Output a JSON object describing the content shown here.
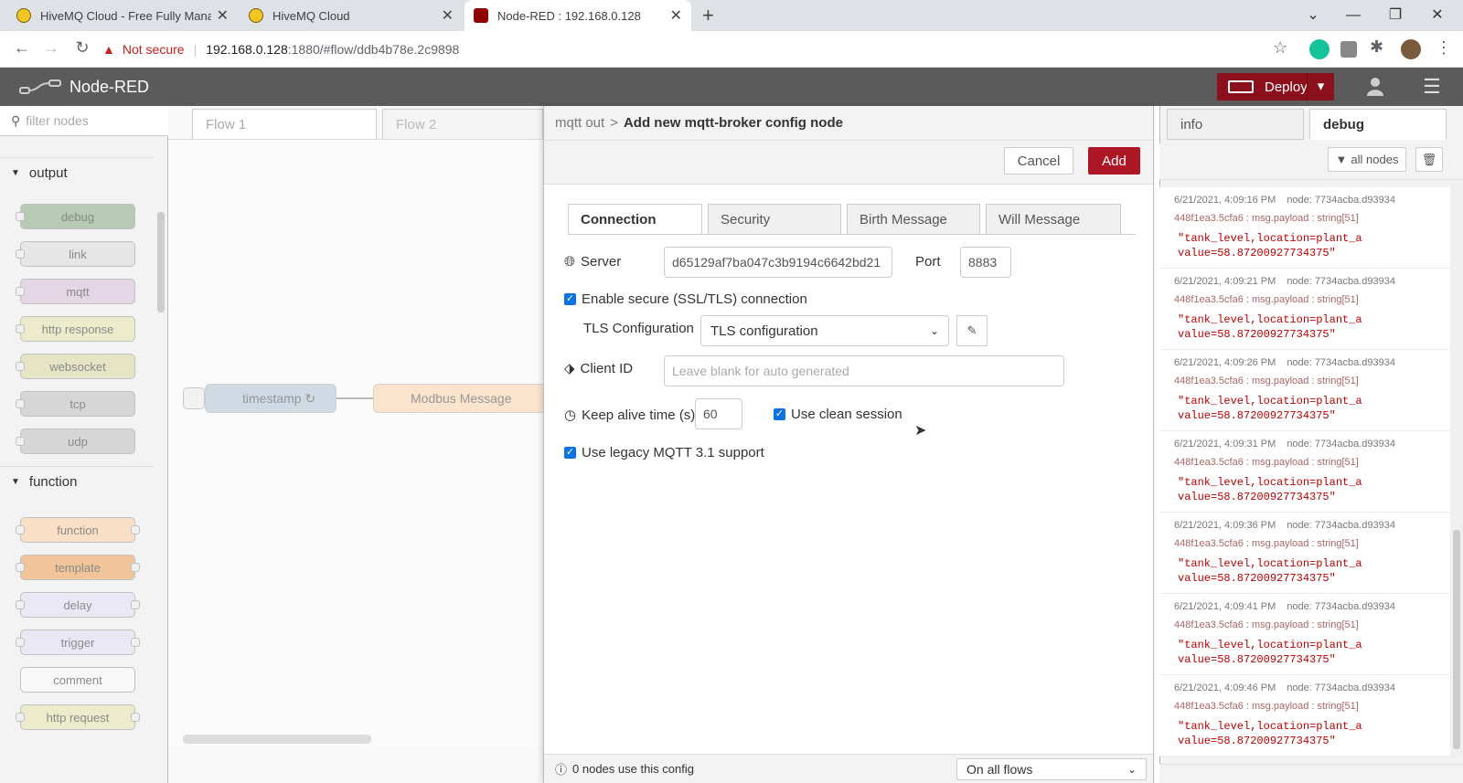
{
  "browser": {
    "tabs": [
      {
        "title": "HiveMQ Cloud - Free Fully Mana"
      },
      {
        "title": "HiveMQ Cloud"
      },
      {
        "title": "Node-RED : 192.168.0.128"
      }
    ],
    "security_label": "Not secure",
    "url_host": "192.168.0.128",
    "url_rest": ":1880/#flow/ddb4b78e.2c9898"
  },
  "app": {
    "name": "Node-RED",
    "deploy_label": "Deploy"
  },
  "palette": {
    "filter_placeholder": "filter nodes",
    "categories": [
      {
        "name": "output",
        "nodes": [
          "debug",
          "link",
          "mqtt",
          "http response",
          "websocket",
          "tcp",
          "udp"
        ]
      },
      {
        "name": "function",
        "nodes": [
          "function",
          "template",
          "delay",
          "trigger",
          "comment",
          "http request"
        ]
      }
    ]
  },
  "workspace": {
    "tabs": [
      "Flow 1",
      "Flow 2"
    ],
    "nodes": [
      {
        "label": "timestamp ↻"
      },
      {
        "label": "Modbus Message"
      }
    ]
  },
  "tray": {
    "breadcrumb_parent": "mqtt out",
    "breadcrumb_sep": ">",
    "title": "Add new mqtt-broker config node",
    "cancel_label": "Cancel",
    "add_label": "Add",
    "tabs": [
      "Connection",
      "Security",
      "Birth Message",
      "Will Message"
    ],
    "server_label": "Server",
    "server_value": "d65129af7ba047c3b9194c6642bd21",
    "port_label": "Port",
    "port_value": "8883",
    "tls_checkbox_label": "Enable secure (SSL/TLS) connection",
    "tls_config_label": "TLS Configuration",
    "tls_config_value": "TLS configuration",
    "client_id_label": "Client ID",
    "client_id_placeholder": "Leave blank for auto generated",
    "keepalive_label": "Keep alive time (s)",
    "keepalive_value": "60",
    "clean_session_label": "Use clean session",
    "legacy_label": "Use legacy MQTT 3.1 support",
    "footer_usage": "0 nodes use this config",
    "scope_value": "On all flows"
  },
  "sidebar": {
    "tabs": [
      "info",
      "debug"
    ],
    "filter_label": "all nodes",
    "messages": [
      {
        "time": "6/21/2021, 4:09:16 PM",
        "node": "node: 7734acba.d93934",
        "topic": "448f1ea3.5cfa6 : msg.payload : string[51]",
        "line1": "\"tank_level,location=plant_a",
        "line2": "value=58.87200927734375\""
      },
      {
        "time": "6/21/2021, 4:09:21 PM",
        "node": "node: 7734acba.d93934",
        "topic": "448f1ea3.5cfa6 : msg.payload : string[51]",
        "line1": "\"tank_level,location=plant_a",
        "line2": "value=58.87200927734375\""
      },
      {
        "time": "6/21/2021, 4:09:26 PM",
        "node": "node: 7734acba.d93934",
        "topic": "448f1ea3.5cfa6 : msg.payload : string[51]",
        "line1": "\"tank_level,location=plant_a",
        "line2": "value=58.87200927734375\""
      },
      {
        "time": "6/21/2021, 4:09:31 PM",
        "node": "node: 7734acba.d93934",
        "topic": "448f1ea3.5cfa6 : msg.payload : string[51]",
        "line1": "\"tank_level,location=plant_a",
        "line2": "value=58.87200927734375\""
      },
      {
        "time": "6/21/2021, 4:09:36 PM",
        "node": "node: 7734acba.d93934",
        "topic": "448f1ea3.5cfa6 : msg.payload : string[51]",
        "line1": "\"tank_level,location=plant_a",
        "line2": "value=58.87200927734375\""
      },
      {
        "time": "6/21/2021, 4:09:41 PM",
        "node": "node: 7734acba.d93934",
        "topic": "448f1ea3.5cfa6 : msg.payload : string[51]",
        "line1": "\"tank_level,location=plant_a",
        "line2": "value=58.87200927734375\""
      },
      {
        "time": "6/21/2021, 4:09:46 PM",
        "node": "node: 7734acba.d93934",
        "topic": "448f1ea3.5cfa6 : msg.payload : string[51]",
        "line1": "\"tank_level,location=plant_a",
        "line2": "value=58.87200927734375\""
      }
    ]
  },
  "colors": {
    "header_bg": "#5b5b5b",
    "deploy_bg": "#8c101c",
    "add_button_bg": "#ad1625",
    "debug_value": "#b00000"
  }
}
